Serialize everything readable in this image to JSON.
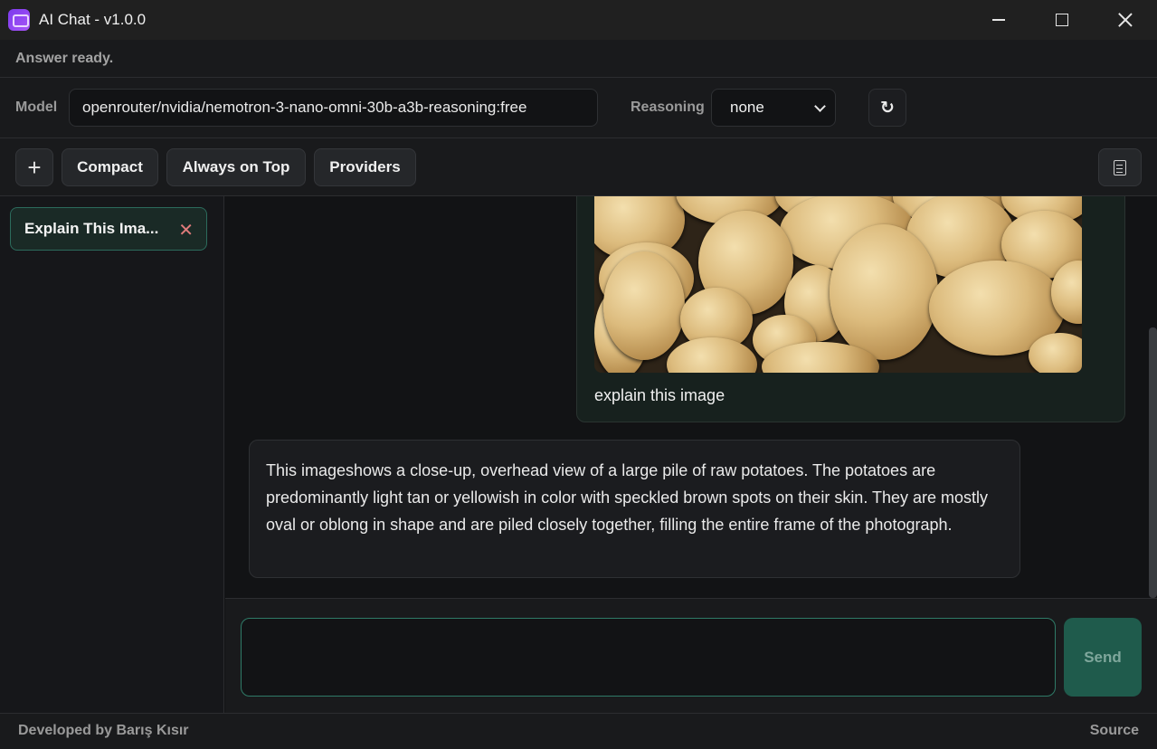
{
  "window": {
    "title": "AI Chat - v1.0.0",
    "icons": {
      "app": "chat-app-icon",
      "minimize": "minimize-icon",
      "maximize": "maximize-icon",
      "close": "close-icon"
    }
  },
  "status": {
    "text": "Answer ready."
  },
  "modelbar": {
    "model_label": "Model",
    "model_value": "openrouter/nvidia/nemotron-3-nano-omni-30b-a3b-reasoning:free",
    "reasoning_label": "Reasoning",
    "reasoning_value": "none",
    "refresh_glyph": "↻"
  },
  "toolbar": {
    "new_glyph": "+",
    "compact_label": "Compact",
    "always_on_top_label": "Always on Top",
    "providers_label": "Providers",
    "doc_icon": "document-icon"
  },
  "sidebar": {
    "chats": [
      {
        "title": "Explain This Ima...",
        "close_glyph": "✕"
      }
    ]
  },
  "messages": {
    "user": {
      "image": "potatoes-photo",
      "text": "explain this image"
    },
    "assistant": {
      "text": "This imageshows a close-up, overhead view of a large pile of raw potatoes. The potatoes are predominantly light tan or yellowish in color with speckled brown spots on their skin. They are mostly oval or oblong in shape and are piled closely together, filling the entire frame of the photograph."
    }
  },
  "composer": {
    "placeholder": "",
    "send_label": "Send"
  },
  "footer": {
    "credit": "Developed by Barış Kısır",
    "source_label": "Source"
  },
  "colors": {
    "accent": "#2f7a67",
    "send_bg": "#1f5b4c",
    "close_x": "#e07b7b",
    "background": "#121315"
  }
}
